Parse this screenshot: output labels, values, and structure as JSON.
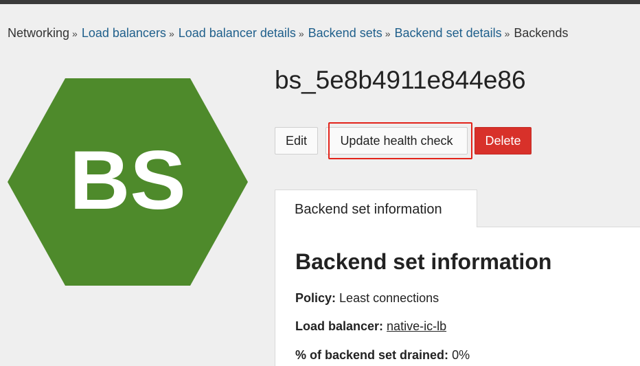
{
  "breadcrumb": [
    {
      "label": "Networking",
      "link": false
    },
    {
      "label": "Load balancers",
      "link": true
    },
    {
      "label": "Load balancer details",
      "link": true
    },
    {
      "label": "Backend sets",
      "link": true
    },
    {
      "label": "Backend set details",
      "link": true
    },
    {
      "label": "Backends",
      "link": false
    }
  ],
  "breadcrumb_separator": "»",
  "badge": {
    "text": "BS",
    "color": "#4e8a2b",
    "shape": "hexagon"
  },
  "page_title": "bs_5e8b4911e844e86",
  "actions": {
    "edit": "Edit",
    "update_health_check": "Update health check",
    "delete": "Delete"
  },
  "tabs": [
    {
      "label": "Backend set information",
      "active": true
    }
  ],
  "info": {
    "heading": "Backend set information",
    "policy_label": "Policy:",
    "policy_value": "Least connections",
    "load_balancer_label": "Load balancer:",
    "load_balancer_value": "native-ic-lb",
    "drained_label": "% of backend set drained:",
    "drained_value": "0%"
  },
  "colors": {
    "link": "#1f5f8b",
    "delete": "#d8312a",
    "highlight": "#e2231a"
  }
}
